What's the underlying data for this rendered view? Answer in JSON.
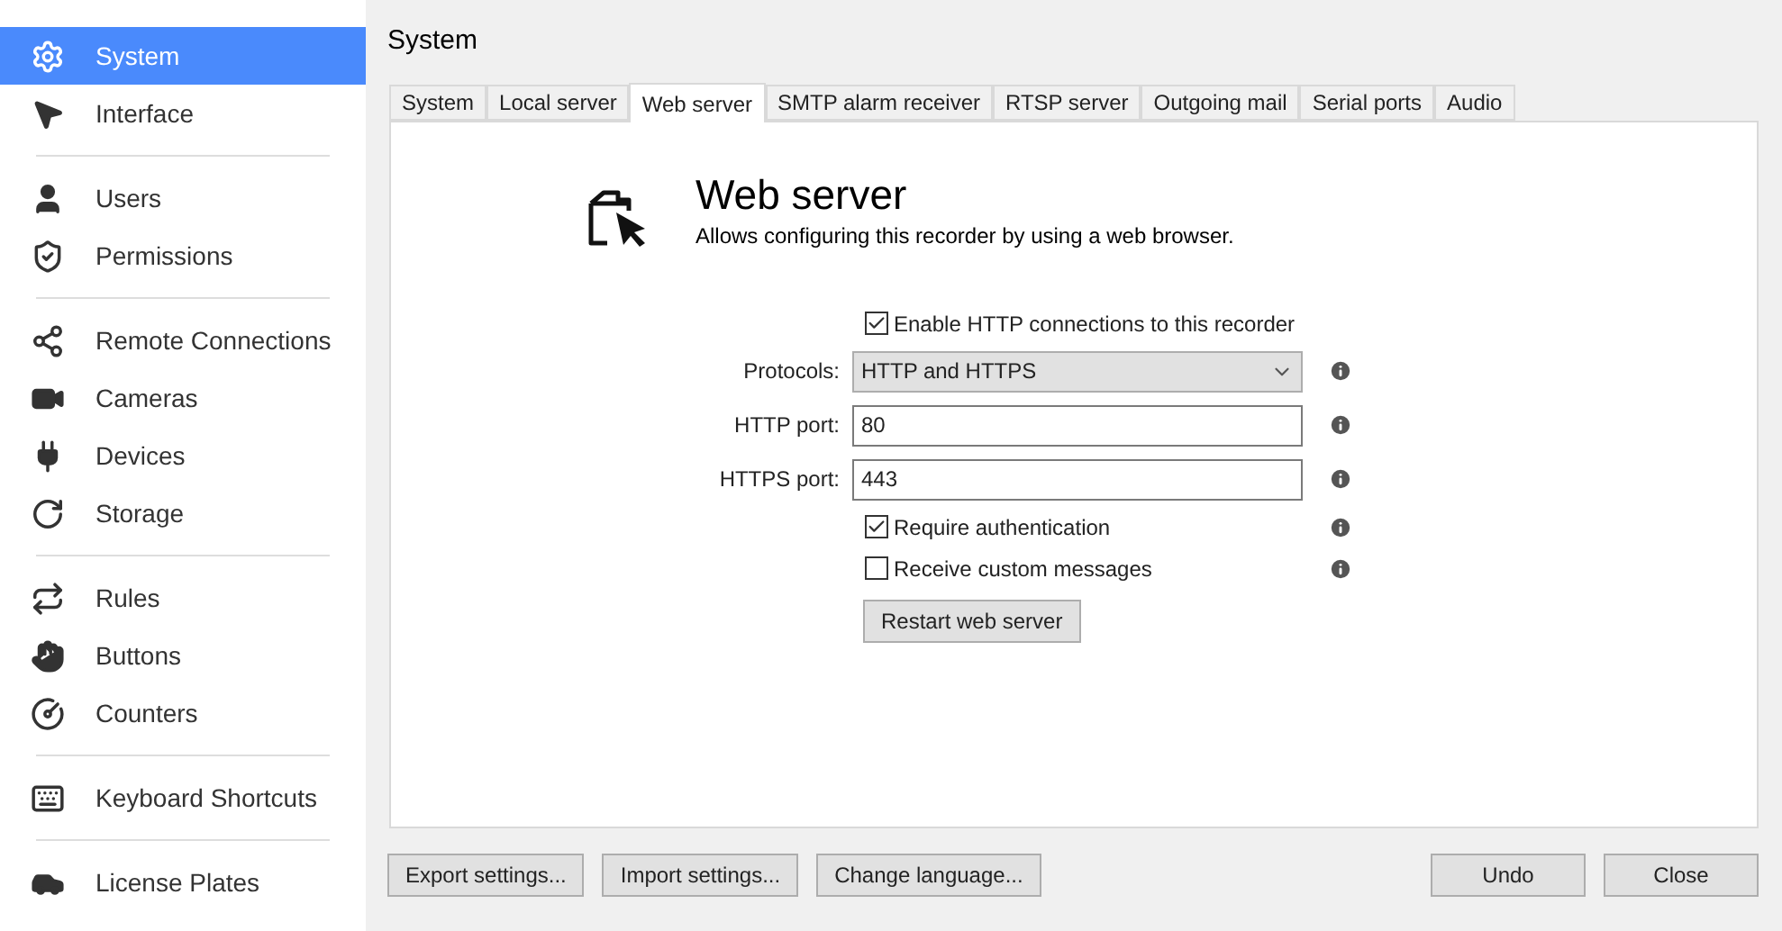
{
  "sidebar": {
    "groups": [
      {
        "items": [
          {
            "label": "System",
            "selected": true
          },
          {
            "label": "Interface",
            "selected": false
          }
        ]
      },
      {
        "items": [
          {
            "label": "Users",
            "selected": false
          },
          {
            "label": "Permissions",
            "selected": false
          }
        ]
      },
      {
        "items": [
          {
            "label": "Remote Connections",
            "selected": false
          },
          {
            "label": "Cameras",
            "selected": false
          },
          {
            "label": "Devices",
            "selected": false
          },
          {
            "label": "Storage",
            "selected": false
          }
        ]
      },
      {
        "items": [
          {
            "label": "Rules",
            "selected": false
          },
          {
            "label": "Buttons",
            "selected": false
          },
          {
            "label": "Counters",
            "selected": false
          }
        ]
      },
      {
        "items": [
          {
            "label": "Keyboard Shortcuts",
            "selected": false
          }
        ]
      },
      {
        "items": [
          {
            "label": "License Plates",
            "selected": false
          }
        ]
      }
    ]
  },
  "page_title": "System",
  "tabs": [
    {
      "label": "System",
      "selected": false
    },
    {
      "label": "Local server",
      "selected": false
    },
    {
      "label": "Web server",
      "selected": true
    },
    {
      "label": "SMTP alarm receiver",
      "selected": false
    },
    {
      "label": "RTSP server",
      "selected": false
    },
    {
      "label": "Outgoing mail",
      "selected": false
    },
    {
      "label": "Serial ports",
      "selected": false
    },
    {
      "label": "Audio",
      "selected": false
    }
  ],
  "section": {
    "title": "Web server",
    "description": "Allows configuring this recorder by using a web browser."
  },
  "form": [
    {
      "kind": "checkbox",
      "label": "Enable HTTP connections to this recorder",
      "checked": true,
      "info": false
    },
    {
      "kind": "select",
      "label": "Protocols:",
      "value": "HTTP and HTTPS",
      "info": true
    },
    {
      "kind": "input",
      "label": "HTTP port:",
      "value": "80",
      "info": true
    },
    {
      "kind": "input",
      "label": "HTTPS port:",
      "value": "443",
      "info": true
    },
    {
      "kind": "checkbox",
      "label": "Require authentication",
      "checked": true,
      "info": true
    },
    {
      "kind": "checkbox",
      "label": "Receive custom messages",
      "checked": false,
      "info": true
    },
    {
      "kind": "button",
      "label": "Restart web server"
    }
  ],
  "footer": {
    "left_buttons": [
      "Export settings...",
      "Import settings...",
      "Change language..."
    ],
    "right_buttons": [
      "Undo",
      "Close"
    ]
  }
}
